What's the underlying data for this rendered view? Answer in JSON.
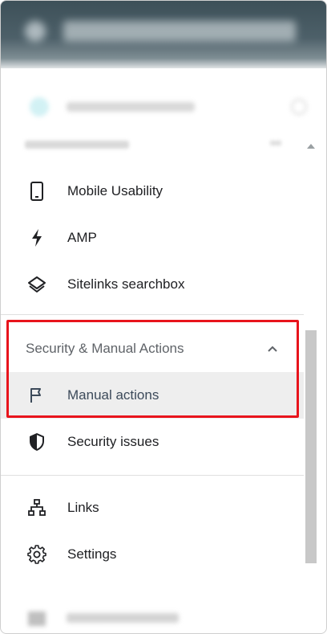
{
  "sidebar": {
    "items_above": [
      {
        "label": "Mobile Usability",
        "icon": "mobile-phone-icon"
      },
      {
        "label": "AMP",
        "icon": "lightning-bolt-icon"
      },
      {
        "label": "Sitelinks searchbox",
        "icon": "layers-icon"
      }
    ],
    "security_section": {
      "title": "Security & Manual Actions",
      "expanded": true,
      "items": [
        {
          "label": "Manual actions",
          "icon": "flag-icon",
          "selected": true
        },
        {
          "label": "Security issues",
          "icon": "shield-icon"
        }
      ]
    },
    "items_below": [
      {
        "label": "Links",
        "icon": "sitemap-icon"
      },
      {
        "label": "Settings",
        "icon": "gear-icon"
      }
    ]
  },
  "colors": {
    "highlight_border": "#e8141c",
    "selected_row_bg": "#eeeeee",
    "text": "#202124",
    "section_text": "#5f6368"
  }
}
